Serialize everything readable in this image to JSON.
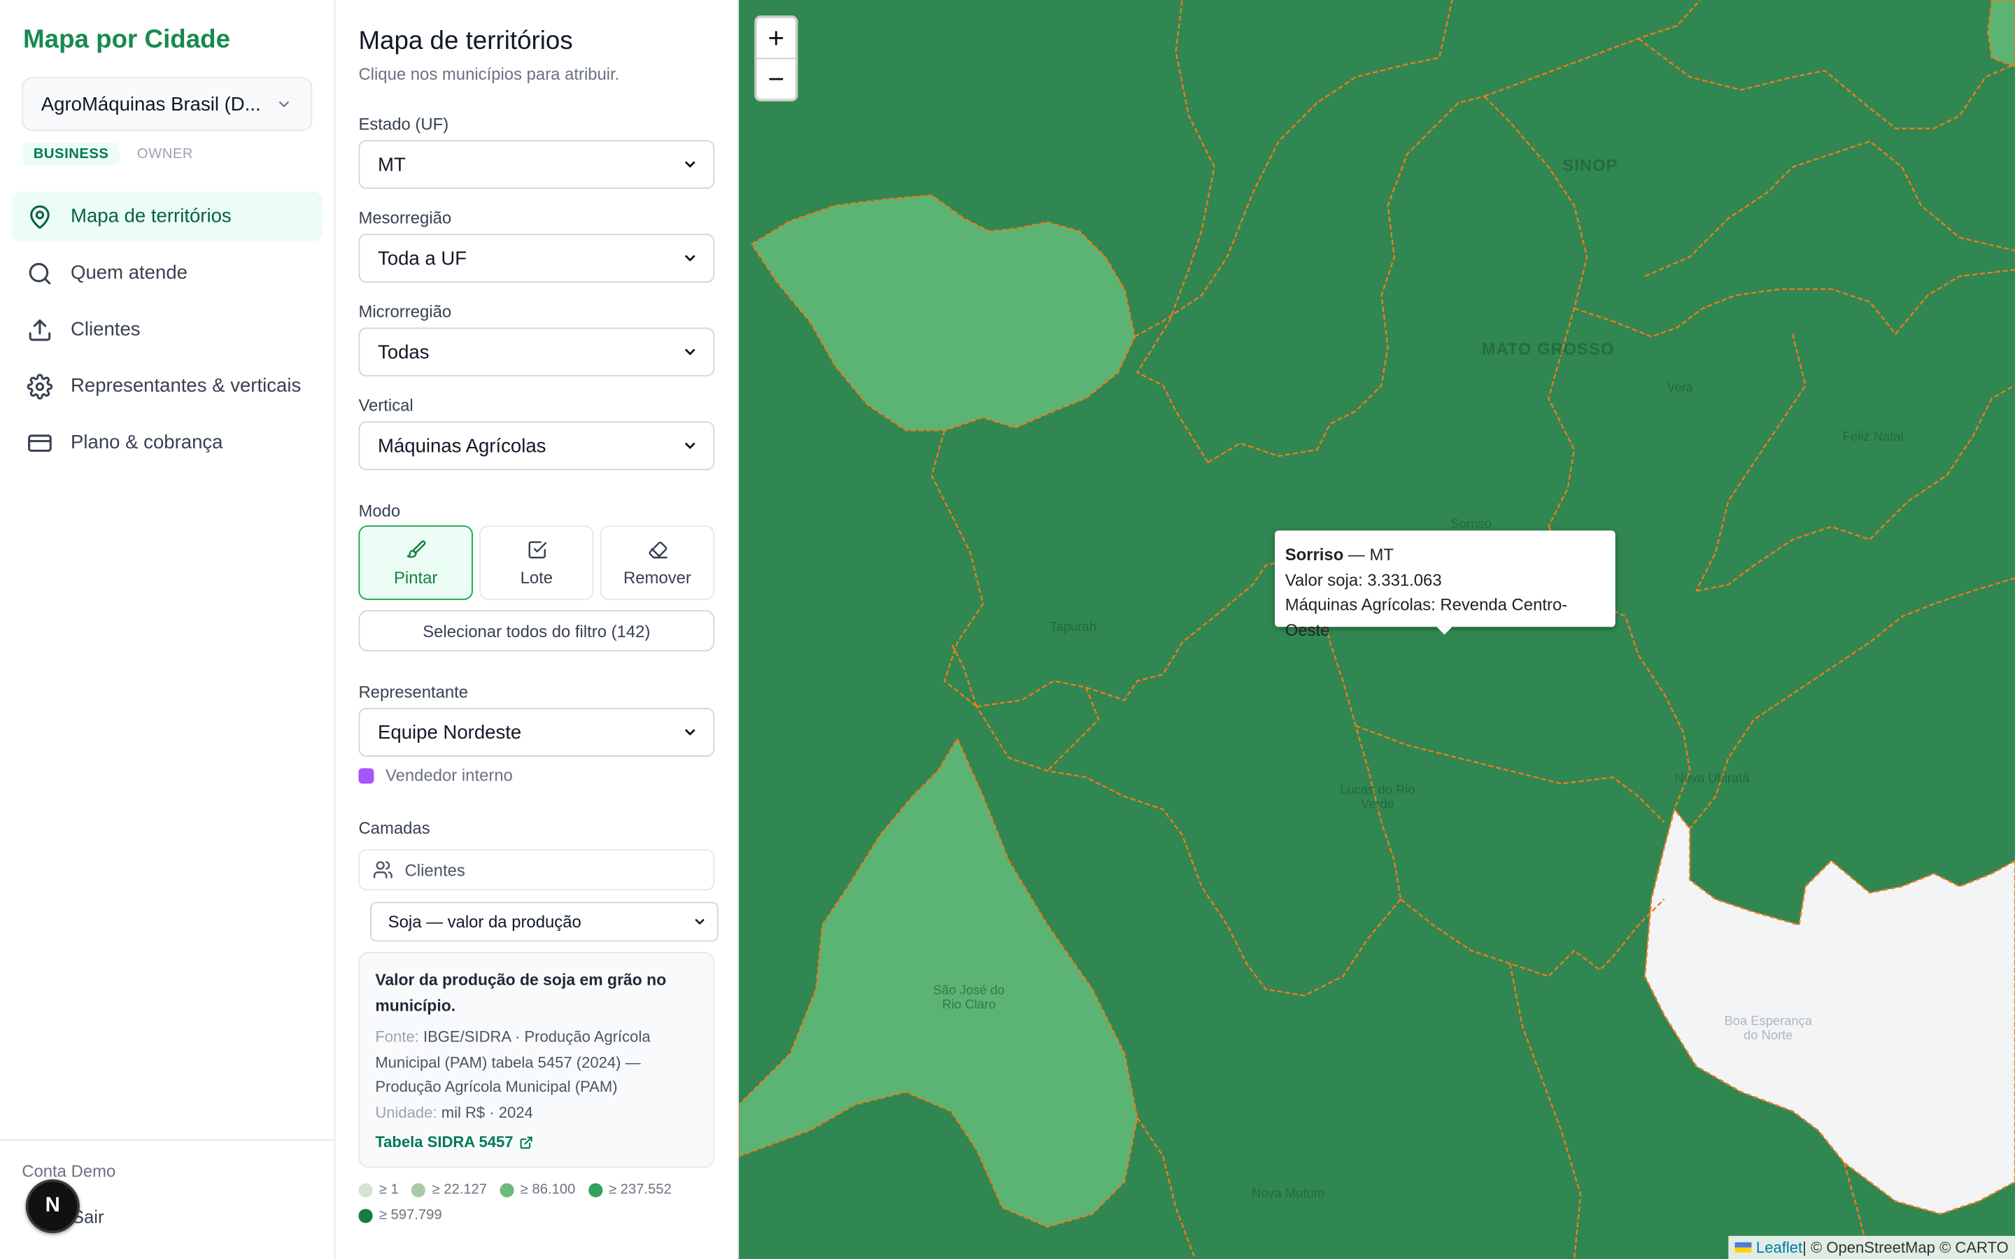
{
  "sidebar": {
    "brand": "Mapa por Cidade",
    "account_select": "AgroMáquinas Brasil (D...",
    "roles": [
      "BUSINESS",
      "OWNER"
    ],
    "nav": [
      {
        "label": "Mapa de territórios",
        "icon": "map-pin-icon",
        "active": true
      },
      {
        "label": "Quem atende",
        "icon": "search-icon",
        "active": false
      },
      {
        "label": "Clientes",
        "icon": "upload-icon",
        "active": false
      },
      {
        "label": "Representantes & verticais",
        "icon": "gear-icon",
        "active": false
      },
      {
        "label": "Plano & cobrança",
        "icon": "credit-card-icon",
        "active": false
      }
    ],
    "account_name": "Conta Demo",
    "logout": "Sair",
    "badge": "N"
  },
  "panel": {
    "title": "Mapa de territórios",
    "subtitle": "Clique nos municípios para atribuir.",
    "estado": {
      "label": "Estado (UF)",
      "value": "MT"
    },
    "mesorregiao": {
      "label": "Mesorregião",
      "value": "Toda a UF"
    },
    "microrregiao": {
      "label": "Microrregião",
      "value": "Todas"
    },
    "vertical": {
      "label": "Vertical",
      "value": "Máquinas Agrícolas"
    },
    "modo": {
      "label": "Modo",
      "buttons": [
        {
          "label": "Pintar",
          "icon": "brush-icon",
          "active": true
        },
        {
          "label": "Lote",
          "icon": "checkbox-icon",
          "active": false
        },
        {
          "label": "Remover",
          "icon": "eraser-icon",
          "active": false
        }
      ]
    },
    "select_all": "Selecionar todos do filtro (142)",
    "representante": {
      "label": "Representante",
      "value": "Equipe Nordeste",
      "legend": "Vendedor interno",
      "legend_color": "#a855f7"
    },
    "camadas": {
      "label": "Camadas",
      "clients": "Clientes",
      "layer": "Soja — valor da produção"
    },
    "info": {
      "title": "Valor da produção de soja em grão no município.",
      "fonte_label": "Fonte:",
      "fonte": "IBGE/SIDRA · Produção Agrícola Municipal (PAM) tabela 5457 (2024) — Produção Agrícola Municipal (PAM)",
      "unidade_label": "Unidade:",
      "unidade": "mil R$ · 2024",
      "link": "Tabela SIDRA 5457"
    },
    "legend": [
      {
        "label": "≥ 1",
        "color": "#d3e4d3"
      },
      {
        "label": "≥ 22.127",
        "color": "#a8c9a8"
      },
      {
        "label": "≥ 86.100",
        "color": "#6dbb7c"
      },
      {
        "label": "≥ 237.552",
        "color": "#34a160"
      },
      {
        "label": "≥ 597.799",
        "color": "#1a7a44"
      }
    ]
  },
  "map": {
    "zoom_in": "+",
    "zoom_out": "−",
    "labels": {
      "sinop": "SINOP",
      "mato_grosso": "MATO GROSSO",
      "vera": "Vera",
      "feliz_natal": "Feliz Natal",
      "sorriso": "Sorriso",
      "tapurah": "Tapurah",
      "lucas": "Lucas do Rio Verde",
      "nova_ubirata": "Nova Ubiratã",
      "sao_jose": "São José do Rio Claro",
      "boa_esperanca": "Boa Esperança do Norte",
      "nova_mutum": "Nova Mutum"
    },
    "tooltip": {
      "name": "Sorriso",
      "uf": " — MT",
      "line1": "Valor soja: 3.331.063",
      "line2": "Máquinas Agrícolas: Revenda Centro-Oeste"
    },
    "attribution": {
      "leaflet": "Leaflet",
      "rest": " | © OpenStreetMap © CARTO"
    },
    "colors": {
      "dark": "#308751",
      "light": "#5bb474",
      "empty": "#f3f4f6",
      "border": "#f07a1e"
    }
  }
}
